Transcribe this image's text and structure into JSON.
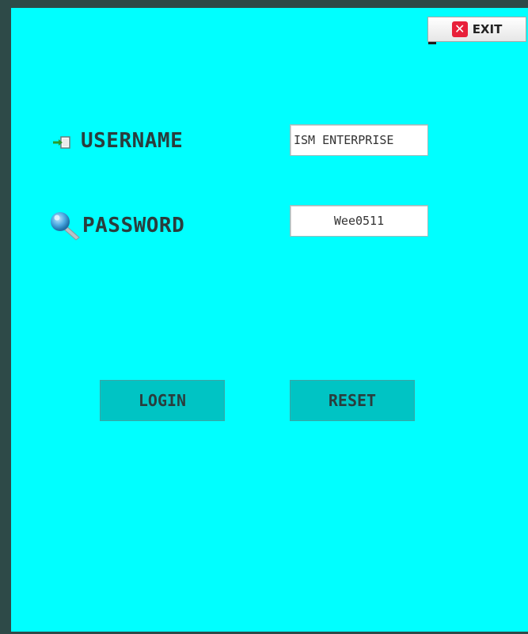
{
  "window": {
    "exit_label": "EXIT",
    "exit_icon": "close-x-icon",
    "background_color": "#00ffff",
    "border_color": "#2e4a48"
  },
  "form": {
    "username": {
      "label": "USERNAME",
      "icon": "login-arrow-icon",
      "value": "ISM ENTERPRISE"
    },
    "password": {
      "label": "PASSWORD",
      "icon": "key-icon",
      "value": "Wee0511"
    }
  },
  "actions": {
    "login_label": "LOGIN",
    "reset_label": "RESET",
    "button_color": "#00c4c4"
  }
}
